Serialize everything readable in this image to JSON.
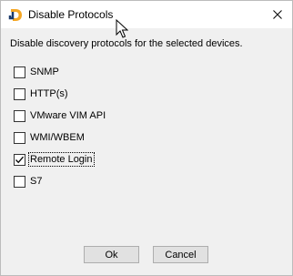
{
  "window": {
    "title": "Disable Protocols"
  },
  "icons": {
    "app": "app-logo-icon",
    "close": "close-icon",
    "cursor": "mouse-pointer-icon"
  },
  "description": "Disable discovery protocols for the selected devices.",
  "options": [
    {
      "label": "SNMP",
      "checked": false
    },
    {
      "label": "HTTP(s)",
      "checked": false
    },
    {
      "label": "VMware VIM API",
      "checked": false
    },
    {
      "label": "WMI/WBEM",
      "checked": false
    },
    {
      "label": "Remote Login",
      "checked": true,
      "focused": true
    },
    {
      "label": "S7",
      "checked": false
    }
  ],
  "buttons": {
    "ok": "Ok",
    "cancel": "Cancel"
  },
  "colors": {
    "logo_orange": "#f5a623",
    "logo_navy": "#1b3a6b"
  }
}
